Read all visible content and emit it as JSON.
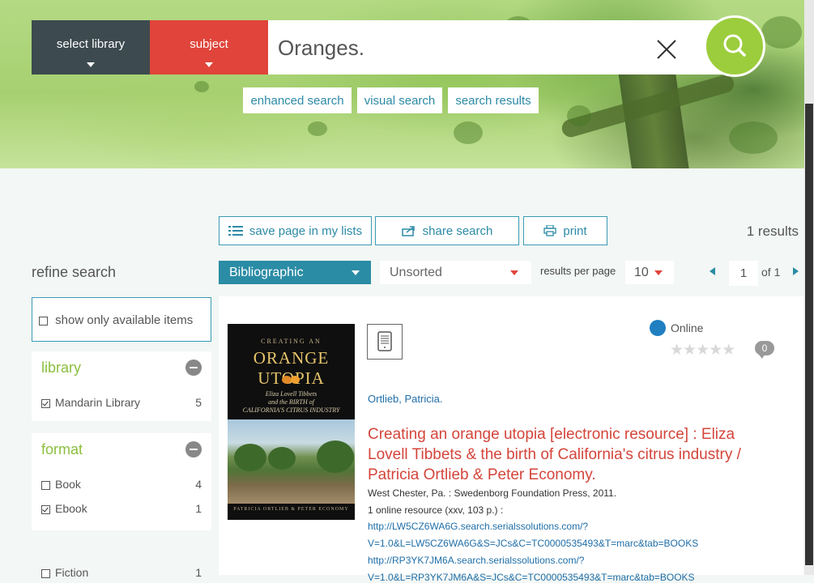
{
  "header": {
    "select_library": "select library",
    "subject": "subject",
    "search_value": "Oranges.",
    "links": [
      "enhanced search",
      "visual search",
      "search results"
    ]
  },
  "toolbar": {
    "save_label": "save page in my lists",
    "share_label": "share search",
    "print_label": "print",
    "results_count": "1 results"
  },
  "controls": {
    "view_mode": "Bibliographic",
    "sort": "Unsorted",
    "rpp_label": "results per page",
    "rpp_value": "10",
    "page": "1",
    "page_of": "of 1"
  },
  "sidebar": {
    "title": "refine search",
    "available_label": "show only available items",
    "library": {
      "title": "library",
      "items": [
        {
          "label": "Mandarin Library",
          "count": "5",
          "checked": true
        }
      ]
    },
    "format": {
      "title": "format",
      "items": [
        {
          "label": "Book",
          "count": "4",
          "checked": false
        },
        {
          "label": "Ebook",
          "count": "1",
          "checked": true
        }
      ]
    },
    "genre": {
      "items": [
        {
          "label": "Fiction",
          "count": "1",
          "checked": false
        }
      ]
    }
  },
  "result": {
    "cover": {
      "top": "CREATING AN",
      "main": "ORANGE UTOPIA",
      "sub1": "Eliza Lovell Tibbets",
      "sub2": "and the BIRTH of",
      "sub3": "CALIFORNIA'S CITRUS INDUSTRY",
      "bottom": "PATRICIA ORTLIEB & PETER ECONOMY"
    },
    "status": "Online",
    "comments": "0",
    "author": "Ortlieb, Patricia.",
    "title": "Creating an orange utopia [electronic resource] : Eliza Lovell Tibbets & the birth of California's citrus industry / Patricia Ortlieb & Peter Economy.",
    "publication": "West Chester, Pa. : Swedenborg Foundation Press, 2011.",
    "extent": "1 online resource (xxv, 103 p.) :",
    "link1_a": "http://LW5CZ6WA6G.search.serialssolutions.com/?",
    "link1_b": "V=1.0&L=LW5CZ6WA6G&S=JCs&C=TC0000535493&T=marc&tab=BOOKS",
    "link2_a": "http://RP3YK7JM6A.search.serialssolutions.com/?",
    "link2_b": "V=1.0&L=RP3YK7JM6A&S=JCs&C=TC0000535493&T=marc&tab=BOOKS"
  },
  "colors": {
    "teal": "#2b8ca5",
    "red": "#e0443a",
    "lime": "#9ccd3c",
    "dark": "#3d4a4f"
  }
}
